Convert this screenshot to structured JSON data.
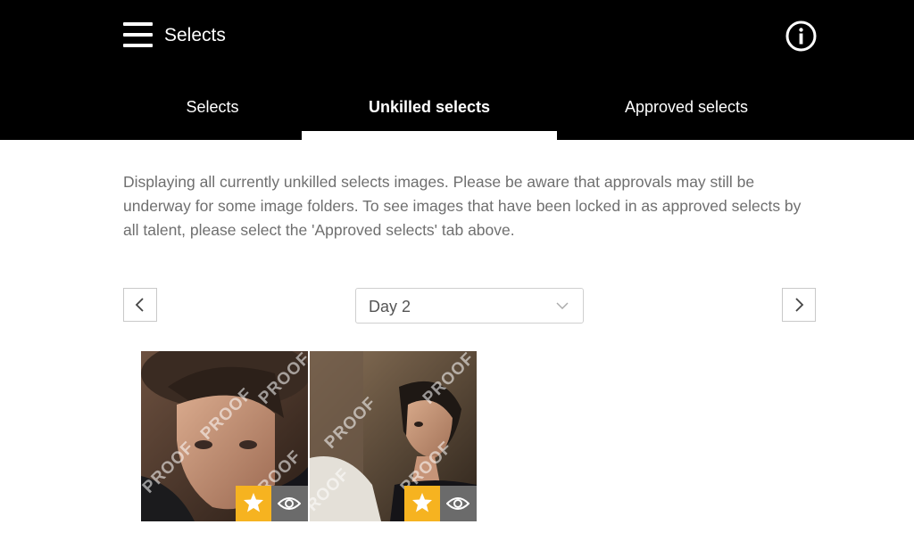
{
  "header": {
    "title": "Selects",
    "menu_icon": "hamburger-icon",
    "info_icon": "info-icon"
  },
  "tabs": [
    {
      "label": "Selects",
      "active": false
    },
    {
      "label": "Unkilled selects",
      "active": true
    },
    {
      "label": "Approved selects",
      "active": false
    }
  ],
  "main": {
    "description": "Displaying all currently unkilled selects images. Please be aware that approvals may still be underway for some image folders. To see images that have been locked in as approved selects by all talent, please select the 'Approved selects' tab above.",
    "day_select": {
      "value": "Day 2"
    },
    "prev_icon": "chevron-left-icon",
    "next_icon": "chevron-right-icon"
  },
  "images": [
    {
      "watermark": "PROOF",
      "star_icon": "star-icon",
      "view_icon": "eye-icon"
    },
    {
      "watermark": "PROOF",
      "star_icon": "star-icon",
      "view_icon": "eye-icon"
    }
  ],
  "colors": {
    "header_bg": "#000000",
    "accent_star": "#f6b320",
    "eye_bg": "#6b6b6b",
    "text_muted": "#6f6f6f"
  }
}
